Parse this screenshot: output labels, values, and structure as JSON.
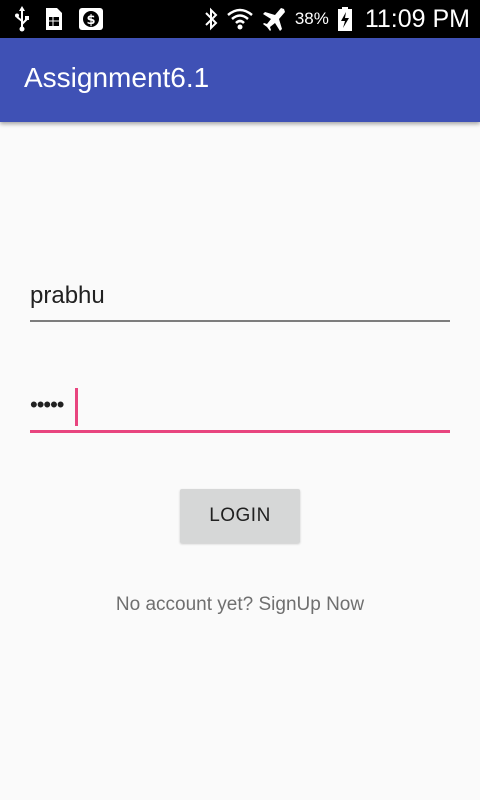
{
  "status_bar": {
    "icons_left": [
      "usb-icon",
      "sim-card-icon",
      "dollar-app-icon"
    ],
    "icons_right": [
      "bluetooth-icon",
      "wifi-icon",
      "airplane-mode-icon"
    ],
    "battery_percent": "38%",
    "time": "11:09 PM"
  },
  "app_bar": {
    "title": "Assignment6.1",
    "color": "#3f51b5"
  },
  "form": {
    "username_value": "prabhu",
    "password_value": "•••••",
    "login_label": "LOGIN",
    "signup_text": "No account yet? SignUp Now",
    "accent_color": "#e8457f"
  }
}
